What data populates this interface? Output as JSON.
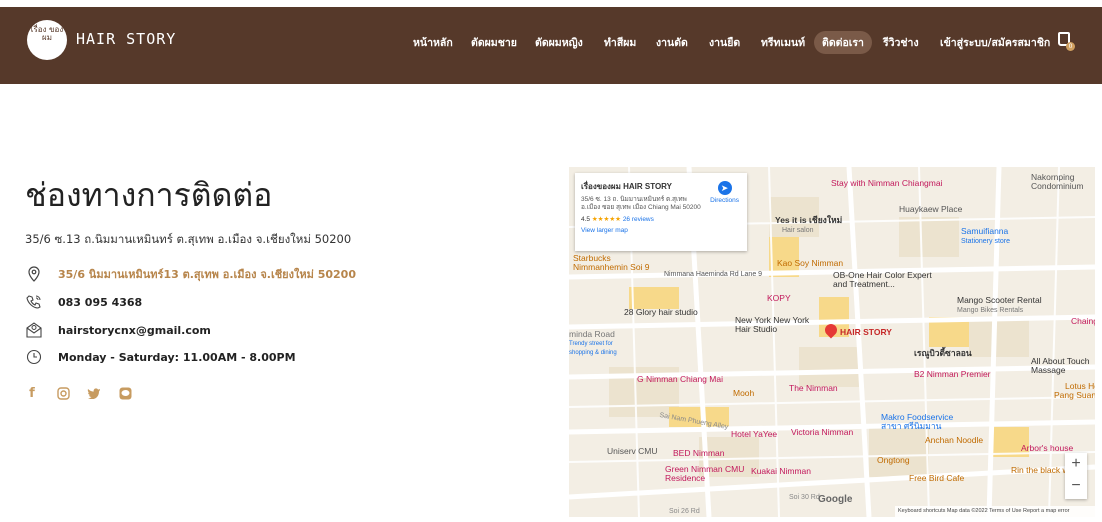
{
  "nav": {
    "logo_text": "เรื่อง ของ ผม",
    "brand": "HAIR STORY",
    "items": [
      {
        "label": "หน้าหลัก"
      },
      {
        "label": "ตัดผมชาย"
      },
      {
        "label": "ตัดผมหญิง"
      },
      {
        "label": "ทำสีผม"
      },
      {
        "label": "งานดัด"
      },
      {
        "label": "งานยืด"
      },
      {
        "label": "ทรีทเมนท์"
      },
      {
        "label": "ติดต่อเรา"
      },
      {
        "label": "รีวิวช่าง"
      },
      {
        "label": "เข้าสู่ระบบ/สมัครสมาชิก"
      }
    ],
    "cart_count": "0",
    "colors": {
      "bar": "#56392a",
      "accent": "#c79b60"
    }
  },
  "contact": {
    "title": "ช่องทางการติดต่อ",
    "address": "35/6 ซ.13 ถ.นิมมานเหมินทร์ ต.สุเทพ อ.เมือง จ.เชียงใหม่ 50200",
    "rows": [
      {
        "icon": "location-pin-icon",
        "text": "35/6 นิมมานเหมินทร์13 ต.สุเทพ อ.เมือง จ.เชียงใหม่ 50200"
      },
      {
        "icon": "phone-icon",
        "text": "083 095 4368"
      },
      {
        "icon": "email-icon",
        "text": "hairstorycnx@gmail.com"
      },
      {
        "icon": "clock-icon",
        "text": "Monday - Saturday: 11.00AM - 8.00PM"
      }
    ],
    "social": [
      "facebook-icon",
      "instagram-icon",
      "twitter-icon",
      "line-icon"
    ]
  },
  "map": {
    "card": {
      "title": "เรื่องของผม HAIR STORY",
      "address": "35/6 ซ. 13 ถ. นิมมานเหมินทร์ ต.สุเทพ อ.เมือง ซอย สุเทพ เมือง Chiang Mai 50200",
      "rating": "4.5",
      "stars": "★★★★★",
      "reviews": "26 reviews",
      "larger_map": "View larger map",
      "directions": "Directions"
    },
    "places": [
      "Stay with Nimman Chiangmai",
      "Huaykaew Place",
      "Nakornping Condominium",
      "Samuifianna",
      "Stationery store",
      "Yes it is เชียงใหม่",
      "Hair salon",
      "Starbucks Nimmanhemin Soi 9",
      "Nimmana Haeminda Rd Lane 9",
      "Kao Soy Nimman",
      "OB-One Hair Color Expert and Treatment...",
      "KOPY",
      "Mango Scooter Rental",
      "Mango Bikes Rentals",
      "28 Glory hair studio",
      "New York New York Hair Studio",
      "HAIR STORY",
      "Chaing M",
      "เรณูบิวตี้ซาลอน",
      "All About Touch Massage",
      "B2 Nimman Premier",
      "G Nimman Chiang Mai",
      "Mooh",
      "The Nimman",
      "Lotus Ho",
      "Pang Suan Ka",
      "Makro Foodservice สาขา ศรีนิมมาน",
      "Hotel YaYee",
      "Victoria Nimman",
      "Anchan Noodle",
      "Arbor's house",
      "Uniserv CMU",
      "BED Nimman",
      "Ongtong",
      "Green Nimman CMU Residence",
      "Kuakai Nimman",
      "Free Bird Cafe",
      "Rin the black we",
      "Sai Nam Phueng Alley",
      "Soi 30 Rd",
      "Soi 26 Rd",
      "minda Road",
      "Trendy street for shopping & dining"
    ],
    "footer": "Keyboard shortcuts   Map data ©2022   Terms of Use   Report a map error",
    "google": "Google"
  }
}
